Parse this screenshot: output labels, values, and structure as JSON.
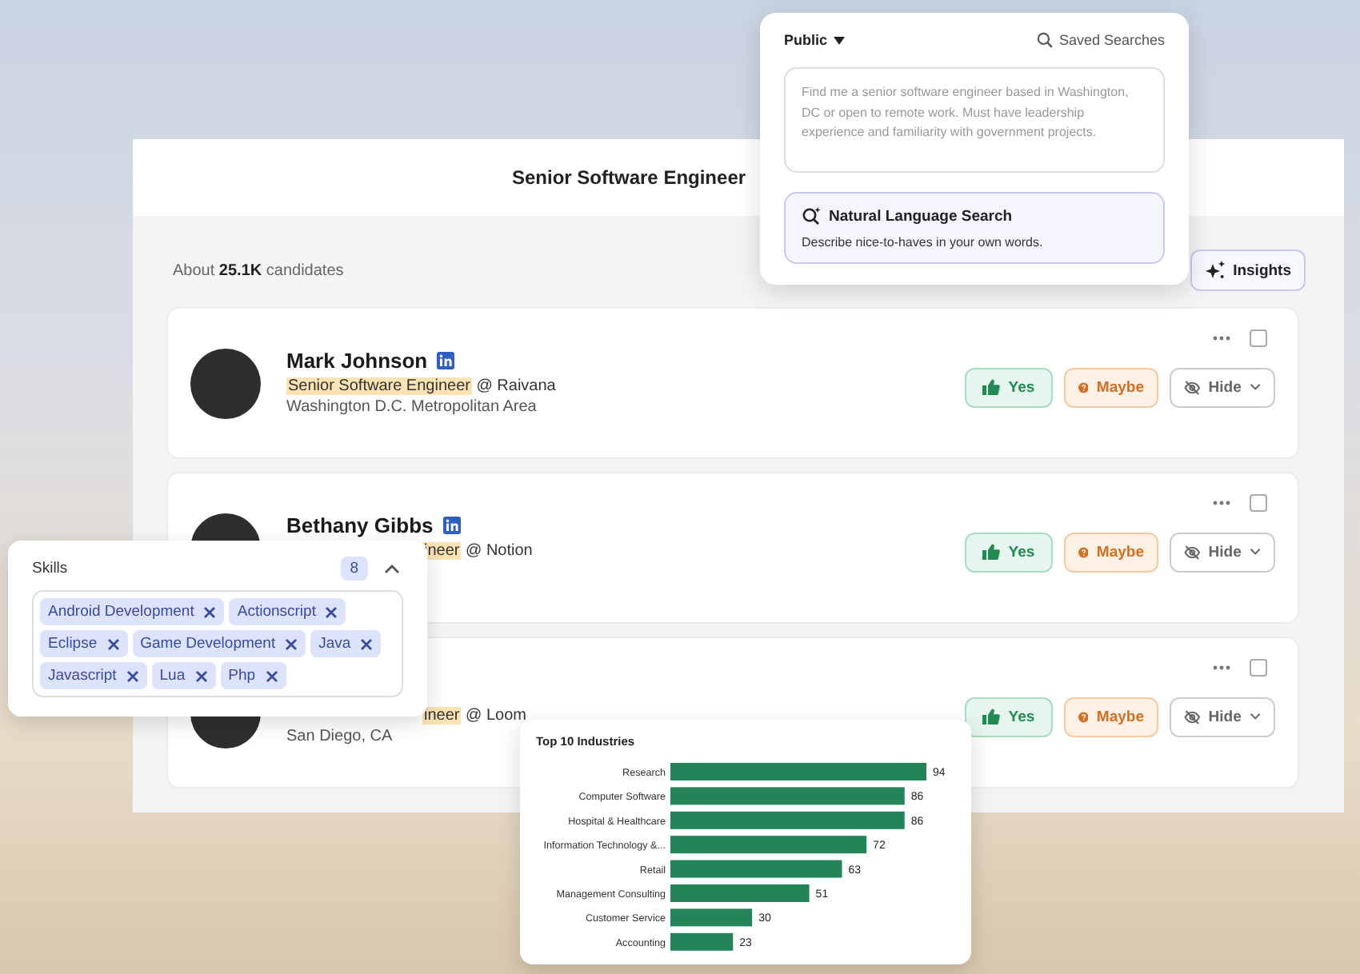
{
  "search_popup": {
    "visibility": "Public",
    "saved_searches": "Saved Searches",
    "query": {
      "placeholder": "Find me a senior software engineer based in Washington, DC or open to remote work. Must have leadership experience and familiarity with government projects."
    },
    "mode": {
      "title": "Natural Language Search",
      "description": "Describe nice-to-haves in your own words."
    }
  },
  "header": {
    "title": "Senior Software Engineer"
  },
  "results": {
    "count_prefix": "About",
    "count": "25.1K",
    "count_suffix": "candidates",
    "insights": "Insights"
  },
  "candidates": [
    {
      "name": "Mark Johnson",
      "title_highlight": "Senior Software Engineer",
      "company": "@ Raivana",
      "location": "Washington D.C. Metropolitan Area",
      "checked": false,
      "actions": [
        "Yes",
        "Maybe",
        "Hide"
      ]
    },
    {
      "name": "Bethany Gibbs",
      "title_highlight": "ineer",
      "company": "@ Notion",
      "checked": false,
      "actions": [
        "Yes",
        "Maybe",
        "Hide"
      ]
    },
    {
      "title_highlight": "ineer",
      "company": "@ Loom",
      "location": "San Diego, CA",
      "checked": false,
      "actions": [
        "Yes",
        "Maybe",
        "Hide"
      ]
    }
  ],
  "skills": {
    "label": "Skills",
    "count": "8",
    "expanded": true,
    "tags": [
      "Android Development",
      "Actionscript",
      "Eclipse",
      "Game Development",
      "Java",
      "Javascript",
      "Lua",
      "Php"
    ]
  },
  "industries": {
    "chart_data": {
      "type": "bar",
      "orientation": "horizontal",
      "title": "Top 10 Industries",
      "categories": [
        "Research",
        "Computer Software",
        "Hospital & Healthcare",
        "Information Technology &...",
        "Retail",
        "Management Consulting",
        "Customer Service",
        "Accounting"
      ],
      "values": [
        94,
        86,
        86,
        72,
        63,
        51,
        30,
        23
      ],
      "data_labels": true
    }
  }
}
